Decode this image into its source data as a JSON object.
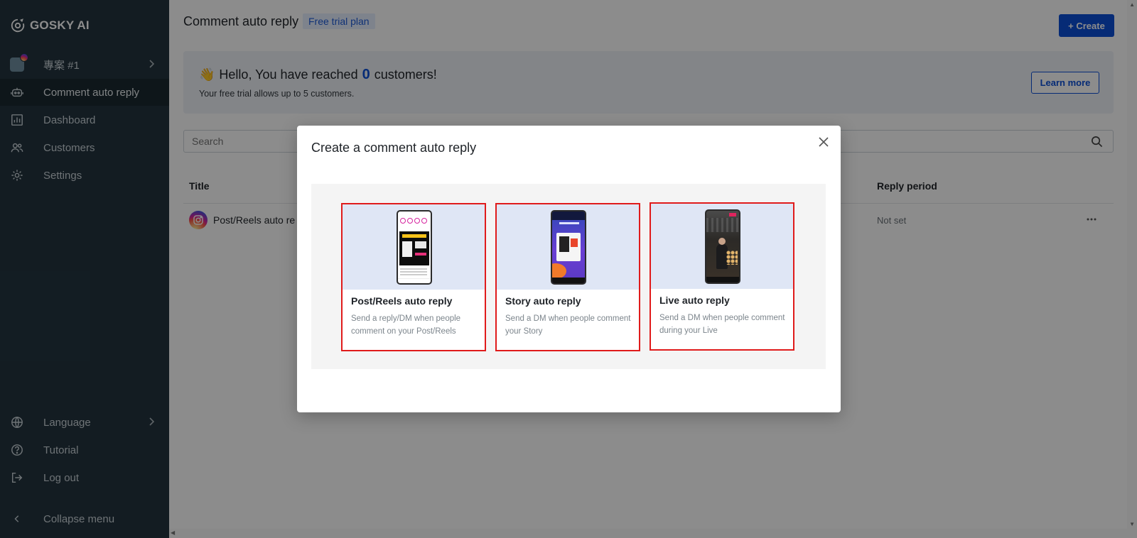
{
  "sidebar": {
    "brand": "GOSKY AI",
    "project": "專案 #1",
    "nav": [
      {
        "label": "Comment auto reply",
        "active": true
      },
      {
        "label": "Dashboard"
      },
      {
        "label": "Customers"
      },
      {
        "label": "Settings"
      }
    ],
    "bottom": [
      {
        "label": "Language"
      },
      {
        "label": "Tutorial"
      },
      {
        "label": "Log out"
      }
    ],
    "collapse": "Collapse menu"
  },
  "header": {
    "title": "Comment auto reply",
    "plan": "Free trial plan",
    "create_label": "+ Create"
  },
  "banner": {
    "greeting_pre": "Hello, You have reached",
    "count": "0",
    "greeting_post": "customers!",
    "subtitle": "Your free trial allows up to 5 customers.",
    "learn_more": "Learn more"
  },
  "search": {
    "placeholder": "Search"
  },
  "table": {
    "columns": [
      "Title",
      "Reply period"
    ],
    "rows": [
      {
        "title": "Post/Reels auto re",
        "period": "Not set"
      }
    ]
  },
  "modal": {
    "title": "Create a comment auto reply",
    "cards": [
      {
        "title": "Post/Reels auto reply",
        "desc": "Send a reply/DM when people comment on your Post/Reels"
      },
      {
        "title": "Story auto reply",
        "desc": "Send a DM when people comment your Story"
      },
      {
        "title": "Live auto reply",
        "desc": "Send a DM when people comment during your Live"
      }
    ]
  },
  "colors": {
    "sidebar_bg": "#23343f",
    "accent": "#0b4fd8",
    "highlight_border": "#e01b1b"
  }
}
